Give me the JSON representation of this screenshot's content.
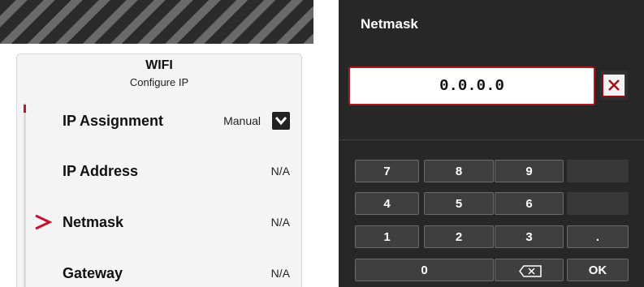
{
  "left_panel": {
    "title": "WIFI",
    "subtitle": "Configure IP",
    "rows": [
      {
        "label": "IP Assignment",
        "value": "Manual"
      },
      {
        "label": "IP Address",
        "value": "N/A"
      },
      {
        "label": "Netmask",
        "value": "N/A"
      },
      {
        "label": "Gateway",
        "value": "N/A"
      }
    ],
    "selected_row": "Netmask"
  },
  "right_panel": {
    "title": "Netmask",
    "field_value": "0.0.0.0",
    "keypad": {
      "row1": [
        "7",
        "8",
        "9"
      ],
      "row2": [
        "4",
        "5",
        "6"
      ],
      "row3": [
        "1",
        "2",
        "3",
        "."
      ],
      "row4": [
        "0",
        "OK"
      ],
      "backspace_icon": "backspace-icon"
    }
  },
  "colors": {
    "accent_red": "#c8102e",
    "panel_dark": "#272727",
    "key_bg": "#3f3f3f"
  }
}
